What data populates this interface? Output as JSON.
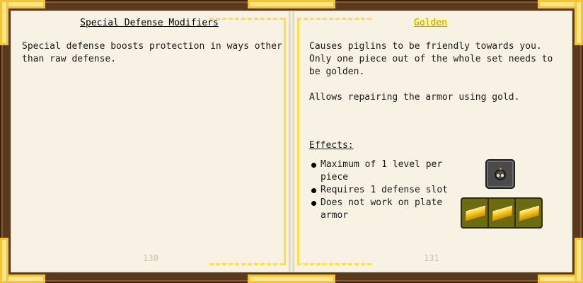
{
  "left_page": {
    "title": "Special Defense Modifiers",
    "body": "Special defense boosts protection in ways other\nthan raw defense.",
    "page_number": "130"
  },
  "right_page": {
    "title": "Golden",
    "body": "Causes piglins to be friendly towards you.\nOnly one piece out of the whole set needs to\nbe golden.\n\nAllows repairing the armor using gold.",
    "effects_heading": "Effects:",
    "effects": [
      "Maximum of 1 level per piece",
      "Requires 1 defense slot",
      "Does not work on plate armor"
    ],
    "page_number": "131"
  },
  "recipe": {
    "result_icon": "golden-modifier-icon",
    "ingredients": [
      "gold-ingot-icon",
      "gold-ingot-icon",
      "gold-ingot-icon"
    ]
  },
  "colors": {
    "accent_gold": "#fde047",
    "page": "#f8f2e4",
    "cover": "#5a3a1e"
  }
}
